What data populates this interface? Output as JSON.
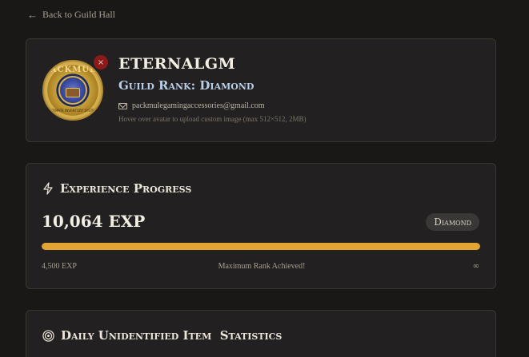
{
  "nav": {
    "back_label": "Back to Guild Hall"
  },
  "profile": {
    "username": "ETERNALGM",
    "guild_rank": "Guild Rank: Diamond",
    "email": "packmulegamingaccessories@gmail.com",
    "upload_hint": "Hover over avatar to upload custom image (max 512×512, 2MB)",
    "avatar_logo_top": "PACKMULE",
    "avatar_logo_bottom": "ULTIMATE INVENTORY SYSTEM",
    "remove_label": "×"
  },
  "experience": {
    "title": "Experience Progress",
    "value": "10,064 EXP",
    "rank_badge": "Diamond",
    "progress_fraction": 1.0,
    "min_label": "4,500 EXP",
    "status_label": "Maximum Rank Achieved!",
    "max_label": "∞"
  },
  "daily": {
    "title": "Daily Unidentified Item  Statistics"
  },
  "colors": {
    "background": "#1a1816",
    "card": "#222020",
    "accent_gold": "#e2a533",
    "rank_blue": "#b8cfe8",
    "remove_red": "#8b1a1a"
  },
  "icons": {
    "back": "arrow-left-icon",
    "remove": "close-icon",
    "email": "mail-icon",
    "experience": "bolt-icon",
    "daily": "target-icon"
  }
}
